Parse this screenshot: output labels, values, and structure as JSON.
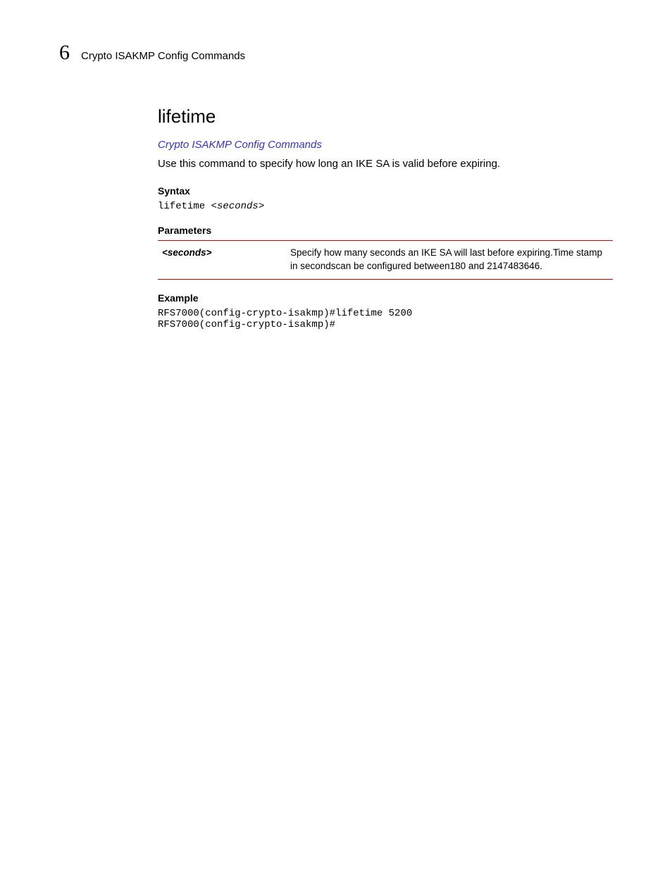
{
  "header": {
    "chapter_number": "6",
    "running_title": "Crypto ISAKMP Config Commands"
  },
  "section": {
    "title": "lifetime",
    "breadcrumb_link": "Crypto ISAKMP Config Commands",
    "intro": "Use this command to specify how long an IKE SA is valid before expiring."
  },
  "syntax": {
    "heading": "Syntax",
    "command": "lifetime ",
    "arg": "<seconds>"
  },
  "parameters": {
    "heading": "Parameters",
    "rows": [
      {
        "name": "<seconds>",
        "desc": "Specify how many seconds an IKE SA will last before expiring.Time stamp in secondscan be configured between180 and 2147483646."
      }
    ]
  },
  "example": {
    "heading": "Example",
    "text": "RFS7000(config-crypto-isakmp)#lifetime 5200\nRFS7000(config-crypto-isakmp)#"
  }
}
